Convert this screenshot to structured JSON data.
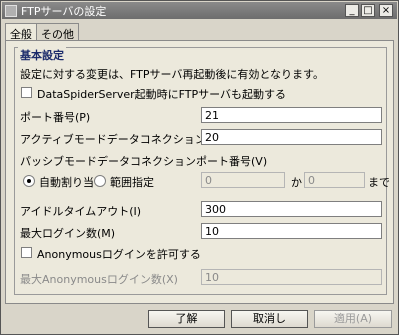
{
  "window": {
    "title": "FTPサーバの設定",
    "btn_minimize": "_",
    "btn_maximize": "□",
    "btn_close": "×"
  },
  "tabs": [
    {
      "label": "全般"
    },
    {
      "label": "その他"
    }
  ],
  "section": {
    "title": "基本設定",
    "note": "設定に対する変更は、FTPサーバ再起動後に有効となります。"
  },
  "fields": {
    "autostart_label": "DataSpiderServer起動時にFTPサーバも起動する",
    "port_label": "ポート番号(P)",
    "port_value": "21",
    "active_port_label": "アクティブモードデータコネクションポート番号(C)",
    "active_port_value": "20",
    "passive_port_label": "パッシブモードデータコネクションポート番号(V)",
    "auto_assign_label": "自動割り当て",
    "range_label": "範囲指定",
    "range_from_value": "0",
    "range_from_suffix": "から",
    "range_to_value": "0",
    "range_to_suffix": "まで",
    "idle_timeout_label": "アイドルタイムアウト(I)",
    "idle_timeout_value": "300",
    "max_login_label": "最大ログイン数(M)",
    "max_login_value": "10",
    "anonymous_label": "Anonymousログインを許可する",
    "max_anon_label": "最大Anonymousログイン数(X)",
    "max_anon_value": "10"
  },
  "buttons": {
    "ok": "了解",
    "cancel": "取消し",
    "apply": "適用(A)"
  }
}
